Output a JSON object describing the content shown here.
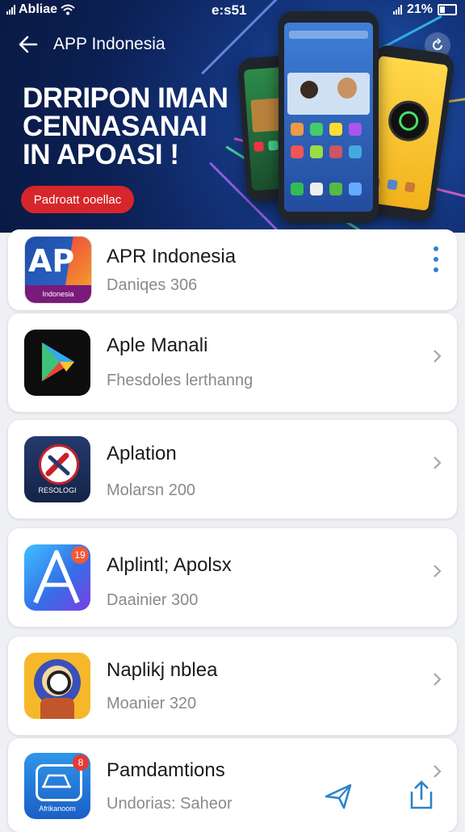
{
  "status_bar": {
    "carrier": "Abliae",
    "time": "e:s51",
    "battery": "21%"
  },
  "header": {
    "title": "APP Indonesia"
  },
  "banner": {
    "headline": [
      "DRRIPON IMAN",
      "CENNASANAI",
      "IN APOASI !"
    ],
    "cta_label": "Padroatt ooellac"
  },
  "apps": [
    {
      "name": "APR Indonesia",
      "subtitle": "Daniqes 306",
      "icon": "ap-logo-icon"
    },
    {
      "name": "Aple Manali",
      "subtitle": "Fhesdoles lerthanng",
      "icon": "play-triangle-icon"
    },
    {
      "name": "Aplation",
      "subtitle": "Molarsn 200",
      "icon": "tools-badge-icon"
    },
    {
      "name": "Alplintl; Apolsx",
      "subtitle": "Daainier 300",
      "icon": "letter-a-icon"
    },
    {
      "name": "Naplikj nblea",
      "subtitle": "Moanier 320",
      "icon": "character-icon"
    },
    {
      "name": "Pamdamtions",
      "subtitle": "Undorias: Saheor",
      "icon": "car-badge-icon"
    }
  ],
  "icon_badges": {
    "app4": "19",
    "app6": "8"
  },
  "icon_captions": {
    "app1": "Indonesia",
    "app3": "RESOLOGI",
    "app6": "Afrikanoom"
  },
  "colors": {
    "banner_bg": "#0b1f52",
    "cta": "#d7262b",
    "menu_dots": "#2f7fd6",
    "fab_accent": "#2b83c8"
  }
}
